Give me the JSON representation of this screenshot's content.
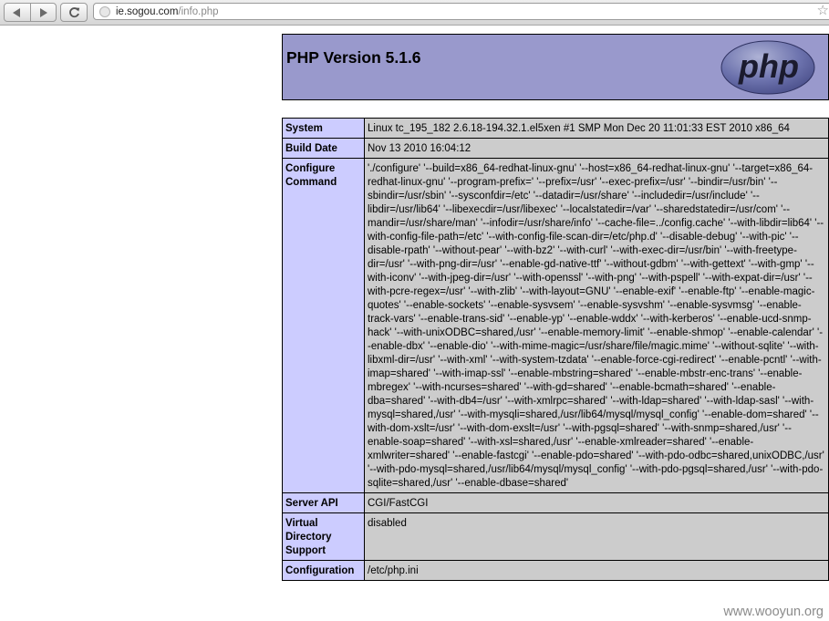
{
  "browser": {
    "back_icon": "back-arrow-icon",
    "forward_icon": "forward-arrow-icon",
    "reload_icon": "reload-icon",
    "url_host": "ie.sogou.com",
    "url_path": "/info.php",
    "bookmark_icon": "star-icon"
  },
  "phpinfo": {
    "title": "PHP Version 5.1.6",
    "logo_text": "php",
    "rows": [
      {
        "label": "System",
        "value": "Linux tc_195_182 2.6.18-194.32.1.el5xen #1 SMP Mon Dec 20 11:01:33 EST 2010 x86_64"
      },
      {
        "label": "Build Date",
        "value": "Nov 13 2010 16:04:12"
      },
      {
        "label": "Configure Command",
        "value": "'./configure' '--build=x86_64-redhat-linux-gnu' '--host=x86_64-redhat-linux-gnu' '--target=x86_64-redhat-linux-gnu' '--program-prefix=' '--prefix=/usr' '--exec-prefix=/usr' '--bindir=/usr/bin' '--sbindir=/usr/sbin' '--sysconfdir=/etc' '--datadir=/usr/share' '--includedir=/usr/include' '--libdir=/usr/lib64' '--libexecdir=/usr/libexec' '--localstatedir=/var' '--sharedstatedir=/usr/com' '--mandir=/usr/share/man' '--infodir=/usr/share/info' '--cache-file=../config.cache' '--with-libdir=lib64' '--with-config-file-path=/etc' '--with-config-file-scan-dir=/etc/php.d' '--disable-debug' '--with-pic' '--disable-rpath' '--without-pear' '--with-bz2' '--with-curl' '--with-exec-dir=/usr/bin' '--with-freetype-dir=/usr' '--with-png-dir=/usr' '--enable-gd-native-ttf' '--without-gdbm' '--with-gettext' '--with-gmp' '--with-iconv' '--with-jpeg-dir=/usr' '--with-openssl' '--with-png' '--with-pspell' '--with-expat-dir=/usr' '--with-pcre-regex=/usr' '--with-zlib' '--with-layout=GNU' '--enable-exif' '--enable-ftp' '--enable-magic-quotes' '--enable-sockets' '--enable-sysvsem' '--enable-sysvshm' '--enable-sysvmsg' '--enable-track-vars' '--enable-trans-sid' '--enable-yp' '--enable-wddx' '--with-kerberos' '--enable-ucd-snmp-hack' '--with-unixODBC=shared,/usr' '--enable-memory-limit' '--enable-shmop' '--enable-calendar' '--enable-dbx' '--enable-dio' '--with-mime-magic=/usr/share/file/magic.mime' '--without-sqlite' '--with-libxml-dir=/usr' '--with-xml' '--with-system-tzdata' '--enable-force-cgi-redirect' '--enable-pcntl' '--with-imap=shared' '--with-imap-ssl' '--enable-mbstring=shared' '--enable-mbstr-enc-trans' '--enable-mbregex' '--with-ncurses=shared' '--with-gd=shared' '--enable-bcmath=shared' '--enable-dba=shared' '--with-db4=/usr' '--with-xmlrpc=shared' '--with-ldap=shared' '--with-ldap-sasl' '--with-mysql=shared,/usr' '--with-mysqli=shared,/usr/lib64/mysql/mysql_config' '--enable-dom=shared' '--with-dom-xslt=/usr' '--with-dom-exslt=/usr' '--with-pgsql=shared' '--with-snmp=shared,/usr' '--enable-soap=shared' '--with-xsl=shared,/usr' '--enable-xmlreader=shared' '--enable-xmlwriter=shared' '--enable-fastcgi' '--enable-pdo=shared' '--with-pdo-odbc=shared,unixODBC,/usr' '--with-pdo-mysql=shared,/usr/lib64/mysql/mysql_config' '--with-pdo-pgsql=shared,/usr' '--with-pdo-sqlite=shared,/usr' '--enable-dbase=shared'"
      },
      {
        "label": "Server API",
        "value": "CGI/FastCGI"
      },
      {
        "label": "Virtual Directory Support",
        "value": "disabled"
      },
      {
        "label": "Configuration",
        "value": "/etc/php.ini"
      }
    ]
  },
  "watermark": "www.wooyun.org",
  "colors": {
    "header_bg": "#9999cc",
    "label_bg": "#ccccff",
    "value_bg": "#cccccc"
  }
}
